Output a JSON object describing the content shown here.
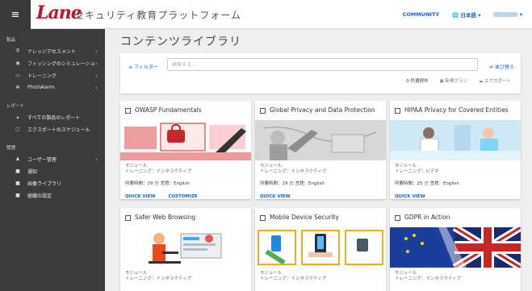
{
  "topbar": {
    "menu_icon": "menu-icon",
    "logo": "Lane",
    "title": "セキュリティ教育プラットフォーム",
    "community": "COMMUNITY",
    "language": "🌐 日本語 ▾",
    "user": "▾"
  },
  "sidebar": {
    "sections": [
      {
        "title": "製品",
        "items": [
          {
            "icon": "shield-icon",
            "glyph": "⛨",
            "label": "ナレッジアセスメント",
            "chevron": true
          },
          {
            "icon": "phishing-icon",
            "glyph": "◉",
            "label": "フィッシングのシミュレーション",
            "chevron": true
          },
          {
            "icon": "training-icon",
            "glyph": "▭",
            "label": "トレーニング",
            "chevron": true
          },
          {
            "icon": "phishalarm-icon",
            "glyph": "✻",
            "label": "PhishAlarm",
            "chevron": true
          }
        ]
      },
      {
        "title": "レポート",
        "items": [
          {
            "icon": "report-icon",
            "glyph": "▴",
            "label": "すべての製品のレポート",
            "chevron": false
          },
          {
            "icon": "schedule-icon",
            "glyph": "▢",
            "label": "エクスポートのスケジュール",
            "chevron": false
          }
        ]
      },
      {
        "title": "管理",
        "items": [
          {
            "icon": "users-icon",
            "glyph": "♟",
            "label": "ユーザー管理",
            "chevron": true
          },
          {
            "icon": "notify-icon",
            "glyph": "■",
            "label": "通知",
            "chevron": false
          },
          {
            "icon": "image-library-icon",
            "glyph": "■",
            "label": "画像ライブラリ",
            "chevron": false
          },
          {
            "icon": "org-settings-icon",
            "glyph": "■",
            "label": "組織の設定",
            "chevron": false
          }
        ]
      }
    ]
  },
  "main": {
    "title": "コンテンツライブラリ",
    "filter_label": "≡ フィルター",
    "search_placeholder": "検索する...",
    "sort_label": "⇌ 並び替え",
    "selected_count": "0 件選択中",
    "action_new_plan": "▣ 新規プラン",
    "action_export": "☁ エクスポート"
  },
  "cards": [
    {
      "title": "OWASP Fundamentals",
      "type": "モジュール",
      "kind": "トレーニング：インタラクティブ",
      "duration": "所要時間：29 分 言語：English",
      "links": [
        "QUICK VIEW",
        "CUSTOMIZE"
      ],
      "theme": "owasp"
    },
    {
      "title": "Global Privacy and Data Protection",
      "type": "モジュール",
      "kind": "トレーニング：インタラクティブ",
      "duration": "所要時間：29 分 言語：English",
      "links": [
        "QUICK VIEW"
      ],
      "theme": "privacy"
    },
    {
      "title": "HIPAA Privacy for Covered Entities",
      "type": "モジュール",
      "kind": "トレーニング：ビデオ",
      "duration": "所要時間：25 分 言語：English",
      "links": [
        "QUICK VIEW"
      ],
      "theme": "hipaa"
    },
    {
      "title": "Safer Web Browsing",
      "type": "モジュール",
      "kind": "トレーニング：インタラクティブ",
      "duration": "",
      "links": [],
      "theme": "web"
    },
    {
      "title": "Mobile Device Security",
      "type": "モジュール",
      "kind": "トレーニング：インタラクティブ",
      "duration": "",
      "links": [],
      "theme": "mobile"
    },
    {
      "title": "GDPR in Action",
      "type": "モジュール",
      "kind": "トレーニング：インタラクティブ",
      "duration": "",
      "links": [],
      "theme": "gdpr"
    }
  ],
  "colors": {
    "accent": "#1565c0",
    "brand": "#c8102e",
    "sidebar": "#3b3b3b"
  }
}
